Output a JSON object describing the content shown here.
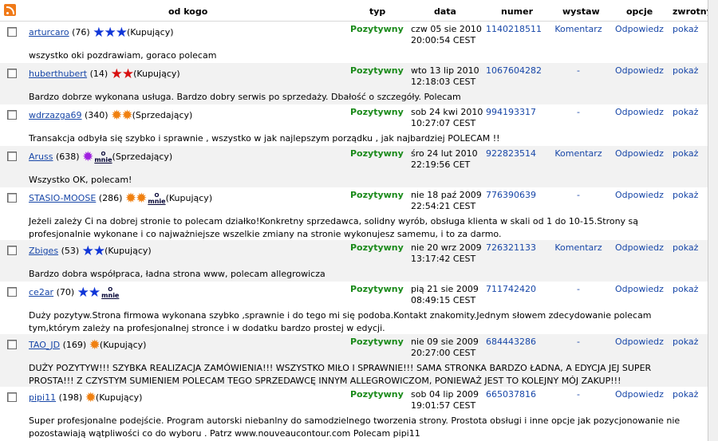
{
  "header": {
    "od_kogo": "od kogo",
    "typ": "typ",
    "data": "data",
    "numer": "numer",
    "wystaw": "wystaw",
    "opcje": "opcje",
    "zwrotny": "zwrotny"
  },
  "rows": [
    {
      "user": "arturcaro",
      "score": "(76)",
      "role": "(Kupujący)",
      "stars": "★★★",
      "star_color": "blue",
      "mnie": false,
      "typ": "Pozytywny",
      "date1": "czw 05 sie 2010",
      "date2": "20:00:54 CEST",
      "num": "1140218511",
      "wystaw": "Komentarz",
      "opcje": "Odpowiedz",
      "zwrotny": "pokaż",
      "comment": "wszystko oki pozdrawiam, goraco polecam"
    },
    {
      "user": "huberthubert",
      "score": "(14)",
      "role": "(Kupujący)",
      "stars": "★★",
      "star_color": "red",
      "mnie": false,
      "typ": "Pozytywny",
      "date1": "wto 13 lip 2010",
      "date2": "12:18:03 CEST",
      "num": "1067604282",
      "wystaw": "-",
      "opcje": "Odpowiedz",
      "zwrotny": "pokaż",
      "comment": "Bardzo dobrze wykonana usługa. Bardzo dobry serwis po sprzedaży. Dbałość o szczegóły. Polecam"
    },
    {
      "user": "wdrzazga69",
      "score": "(340)",
      "role": "(Sprzedający)",
      "stars": "✹✹",
      "star_color": "orange",
      "mnie": false,
      "typ": "Pozytywny",
      "date1": "sob 24 kwi 2010",
      "date2": "10:27:07 CEST",
      "num": "994193317",
      "wystaw": "-",
      "opcje": "Odpowiedz",
      "zwrotny": "pokaż",
      "comment": "Transakcja odbyła się szybko i sprawnie , wszystko w jak najlepszym porządku , jak najbardziej POLECAM !!"
    },
    {
      "user": "Aruss",
      "score": "(638)",
      "role": "(Sprzedający)",
      "stars": "✹",
      "star_color": "purple",
      "mnie": true,
      "typ": "Pozytywny",
      "date1": "śro 24 lut 2010",
      "date2": "22:19:56 CET",
      "num": "922823514",
      "wystaw": "Komentarz",
      "opcje": "Odpowiedz",
      "zwrotny": "pokaż",
      "comment": "Wszystko OK, polecam!"
    },
    {
      "user": "STASIO-MOOSE",
      "score": "(286)",
      "role": "(Kupujący)",
      "stars": "✹✹",
      "star_color": "orange",
      "mnie": true,
      "typ": "Pozytywny",
      "date1": "nie 18 paź 2009",
      "date2": "22:54:21 CEST",
      "num": "776390639",
      "wystaw": "-",
      "opcje": "Odpowiedz",
      "zwrotny": "pokaż",
      "comment": "Jeżeli zależy Ci na dobrej stronie to polecam działko!Konkretny sprzedawca, solidny wyrób, obsługa klienta w skali od 1 do 10-15.Strony są profesjonalnie wykonane i co najważniejsze wszelkie zmiany na stronie wykonujesz samemu, i to za darmo."
    },
    {
      "user": "Zbiges",
      "score": "(53)",
      "role": "(Kupujący)",
      "stars": "★★",
      "star_color": "blue",
      "mnie": false,
      "typ": "Pozytywny",
      "date1": "nie 20 wrz 2009",
      "date2": "13:17:42 CEST",
      "num": "726321133",
      "wystaw": "Komentarz",
      "opcje": "Odpowiedz",
      "zwrotny": "pokaż",
      "comment": "Bardzo dobra współpraca, ładna strona www, polecam allegrowicza"
    },
    {
      "user": "ce2ar",
      "score": "(70)",
      "role": "",
      "stars": "★★",
      "star_color": "blue",
      "mnie": true,
      "typ": "Pozytywny",
      "date1": "pią 21 sie 2009",
      "date2": "08:49:15 CEST",
      "num": "711742420",
      "wystaw": "-",
      "opcje": "Odpowiedz",
      "zwrotny": "pokaż",
      "comment": "Duży pozytyw.Strona firmowa wykonana szybko ,sprawnie i do tego mi się podoba.Kontakt znakomity.Jednym słowem zdecydowanie polecam tym,którym zależy na profesjonalnej stronce i w dodatku bardzo prostej w edycji."
    },
    {
      "user": "TAO_JD",
      "score": "(169)",
      "role": "(Kupujący)",
      "stars": "✹",
      "star_color": "orange",
      "mnie": false,
      "typ": "Pozytywny",
      "date1": "nie 09 sie 2009",
      "date2": "20:27:00 CEST",
      "num": "684443286",
      "wystaw": "-",
      "opcje": "Odpowiedz",
      "zwrotny": "pokaż",
      "comment": "DUŻY POZYTYW!!! SZYBKA REALIZACJA ZAMÓWIENIA!!! WSZYSTKO MIŁO I SPRAWNIE!!! SAMA STRONKA BARDZO ŁADNA, A EDYCJA JEJ SUPER PROSTA!!! Z CZYSTYM SUMIENIEM POLECAM TEGO SPRZEDAWCĘ INNYM ALLEGROWICZOM, PONIEWAŻ JEST TO KOLEJNY MÓJ ZAKUP!!!"
    },
    {
      "user": "pipi11",
      "score": "(198)",
      "role": "(Kupujący)",
      "stars": "✹",
      "star_color": "orange",
      "mnie": false,
      "typ": "Pozytywny",
      "date1": "sob 04 lip 2009",
      "date2": "19:01:57 CEST",
      "num": "665037816",
      "wystaw": "-",
      "opcje": "Odpowiedz",
      "zwrotny": "pokaż",
      "comment": "Super profesjonalne podejście. Program autorski niebanlny do samodzielnego tworzenia strony. Prostota obsługi i inne opcje jak pozycjonowanie nie pozostawiają wątpliwości co do wyboru . Patrz www.nouveaucontour.com Polecam pipi11"
    }
  ],
  "mnie_label_top": "O",
  "mnie_label": "mnie"
}
